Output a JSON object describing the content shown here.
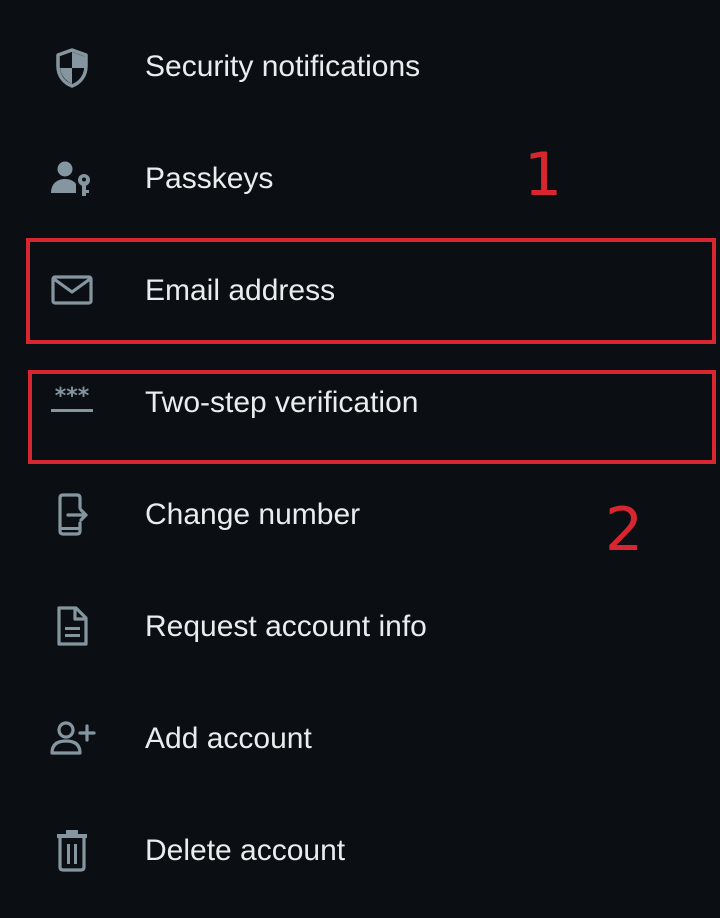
{
  "colors": {
    "background": "#0b0f13",
    "text": "#e9edef",
    "icon": "#8696a0",
    "annotation": "#d7262f"
  },
  "menu": {
    "items": [
      {
        "label": "Security notifications",
        "icon": "shield-icon"
      },
      {
        "label": "Passkeys",
        "icon": "person-key-icon"
      },
      {
        "label": "Email address",
        "icon": "mail-icon"
      },
      {
        "label": "Two-step verification",
        "icon": "asterisks-icon"
      },
      {
        "label": "Change number",
        "icon": "phone-change-icon"
      },
      {
        "label": "Request account info",
        "icon": "document-icon"
      },
      {
        "label": "Add account",
        "icon": "add-person-icon"
      },
      {
        "label": "Delete account",
        "icon": "trash-icon"
      }
    ]
  },
  "annotations": {
    "first_number": "1",
    "second_number": "2"
  }
}
